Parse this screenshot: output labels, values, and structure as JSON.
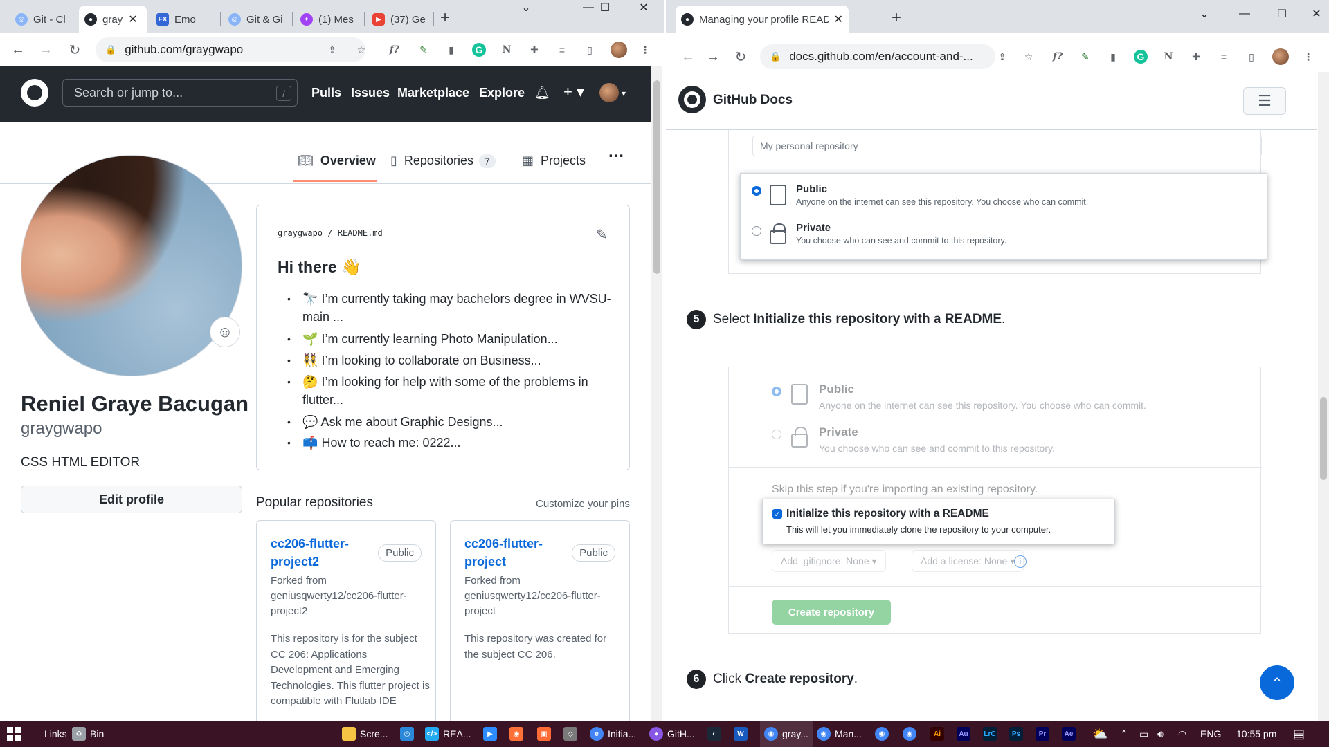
{
  "left_browser": {
    "tabs": [
      {
        "label": "Git - Cl",
        "color": "#8ab4f8"
      },
      {
        "label": "gray",
        "color": "#24292f",
        "active": true
      },
      {
        "label": "Emo",
        "color": "#f9ab00"
      },
      {
        "label": "Git & Gi",
        "color": "#8ab4f8"
      },
      {
        "label": "(1) Mes",
        "color": "#a142f4"
      },
      {
        "label": "(37) Ge",
        "color": "#ea4335"
      }
    ],
    "address": "github.com/graygwapo"
  },
  "github": {
    "search_placeholder": "Search or jump to...",
    "slash_key": "/",
    "nav": [
      "Pulls",
      "Issues",
      "Marketplace",
      "Explore"
    ],
    "profile_tabs": {
      "overview": "Overview",
      "repositories": "Repositories",
      "repositories_count": "7",
      "projects": "Projects"
    },
    "more": "…",
    "user": {
      "full_name": "Reniel Graye Bacugan",
      "username": "graygwapo",
      "bio": "CSS HTML EDITOR",
      "edit_profile": "Edit profile"
    },
    "readme": {
      "path_user": "graygwapo",
      "path_sep": "/",
      "path_file": "README.md",
      "heading": "Hi there 👋",
      "items": [
        {
          "icon": "🔭",
          "text": "I’m currently taking may bachelors degree in WVSU-main ..."
        },
        {
          "icon": "🌱",
          "text": "I’m currently learning Photo Manipulation..."
        },
        {
          "icon": "👯",
          "text": "I’m looking to collaborate on Business..."
        },
        {
          "icon": "🤔",
          "text": "I’m looking for help with some of the problems in flutter..."
        },
        {
          "icon": "💬",
          "text": "Ask me about Graphic Designs..."
        },
        {
          "icon": "📫",
          "text": "How to reach me: 0222..."
        }
      ]
    },
    "popular": {
      "title": "Popular repositories",
      "customize": "Customize your pins",
      "repos": [
        {
          "name": "cc206-flutter-project2",
          "visibility": "Public",
          "forked": "Forked from geniusqwerty12/cc206-flutter-project2",
          "description": "This repository is for the subject CC 206: Applications Development and Emerging Technologies. This flutter project is compatible with Flutlab IDE"
        },
        {
          "name": "cc206-flutter-project",
          "visibility": "Public",
          "forked": "Forked from geniusqwerty12/cc206-flutter-project",
          "description": "This repository was created for the subject CC 206."
        }
      ]
    }
  },
  "right_browser": {
    "tab_title": "Managing your profile README",
    "address": "docs.github.com/en/account-and-..."
  },
  "docs": {
    "brand": "GitHub Docs",
    "repo_desc_placeholder": "My personal repository",
    "public_title": "Public",
    "public_desc": "Anyone on the internet can see this repository. You choose who can commit.",
    "private_title": "Private",
    "private_desc": "You choose who can see and commit to this repository.",
    "step5_num": "5",
    "step5_pre": "Select ",
    "step5_bold": "Initialize this repository with a README",
    "step5_post": ".",
    "skip_text": "Skip this step if you're importing an existing repository.",
    "init_title": "Initialize this repository with a README",
    "init_desc": "This will let you immediately clone the repository to your computer.",
    "gitignore": "Add .gitignore: None ▾",
    "license": "Add a license: None ▾",
    "info": "i",
    "create_btn": "Create repository",
    "step6_num": "6",
    "step6_pre": "Click ",
    "step6_bold": "Create repository",
    "step6_post": "."
  },
  "taskbar": {
    "links": "Links",
    "bin": "Bin",
    "apps": [
      {
        "label": "Scre...",
        "color": "#f6c445"
      },
      {
        "label": "",
        "color": "#2b88d8"
      },
      {
        "label": "REA...",
        "color": "#23a9f2"
      },
      {
        "label": "",
        "color": "#2d8cff"
      },
      {
        "label": "",
        "color": "#ff7139"
      },
      {
        "label": "",
        "color": "#ff6b35"
      },
      {
        "label": "",
        "color": "#7a7a7a"
      },
      {
        "label": "Initia...",
        "color": "#4285f4"
      },
      {
        "label": "GitH...",
        "color": "#8957e5"
      },
      {
        "label": "",
        "color": "#1b2838"
      },
      {
        "label": "",
        "color": "#185abd"
      },
      {
        "label": "gray...",
        "color": "#4285f4"
      },
      {
        "label": "Man...",
        "color": "#4285f4"
      },
      {
        "label": "",
        "color": "#4285f4"
      },
      {
        "label": "",
        "color": "#4285f4"
      },
      {
        "label": "Ai",
        "color": "#330000"
      },
      {
        "label": "Au",
        "color": "#00005b"
      },
      {
        "label": "LrC",
        "color": "#001e36"
      },
      {
        "label": "Ps",
        "color": "#001e36"
      },
      {
        "label": "Pr",
        "color": "#00005b"
      },
      {
        "label": "Ae",
        "color": "#00005b"
      }
    ],
    "lang": "ENG",
    "time": "10:55 pm"
  }
}
